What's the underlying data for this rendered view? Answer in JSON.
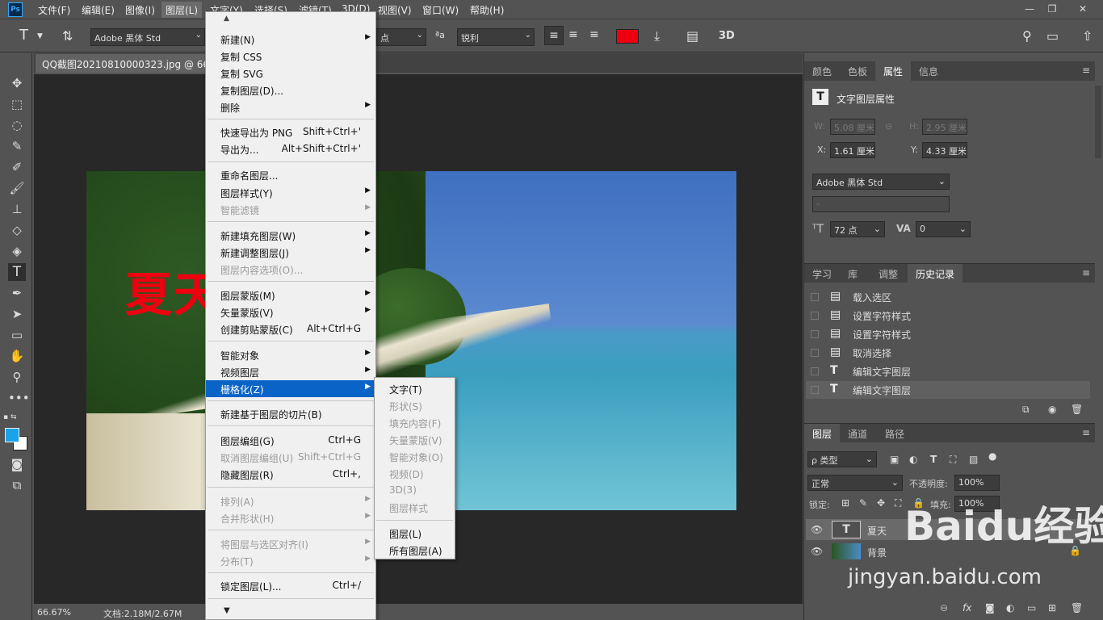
{
  "menubar": {
    "logo": "Ps",
    "items": [
      "文件(F)",
      "编辑(E)",
      "图像(I)",
      "图层(L)",
      "文字(Y)",
      "选择(S)",
      "滤镜(T)",
      "3D(D)",
      "视图(V)",
      "窗口(W)",
      "帮助(H)"
    ]
  },
  "options": {
    "font_family": "Adobe 黑体 Std",
    "size_unit": "点",
    "aa_label": "ªa",
    "aa_mode": "锐利",
    "color": "#ee0010",
    "threed": "3D"
  },
  "document": {
    "tab_title": "QQ截图20210810000323.jpg @ 66.7%",
    "canvas_text": "夏天"
  },
  "status": {
    "zoom": "66.67%",
    "doc_size": "文档:2.18M/2.67M"
  },
  "properties": {
    "tabs": [
      "颜色",
      "色板",
      "属性",
      "信息"
    ],
    "header": "文字图层属性",
    "w_label": "W:",
    "w_value": "5.08 厘米",
    "h_label": "H:",
    "h_value": "2.95 厘米",
    "x_label": "X:",
    "x_value": "1.61 厘米",
    "y_label": "Y:",
    "y_value": "4.33 厘米",
    "font": "Adobe 黑体 Std",
    "style": "-",
    "size": "72 点",
    "tracking": "0"
  },
  "history": {
    "tabs": [
      "学习",
      "库",
      "调整",
      "历史记录"
    ],
    "items": [
      {
        "icon": "doc",
        "label": "载入选区"
      },
      {
        "icon": "doc",
        "label": "设置字符样式"
      },
      {
        "icon": "doc",
        "label": "设置字符样式"
      },
      {
        "icon": "doc",
        "label": "取消选择"
      },
      {
        "icon": "T",
        "label": "编辑文字图层"
      },
      {
        "icon": "T",
        "label": "编辑文字图层"
      }
    ]
  },
  "layers": {
    "tabs": [
      "图层",
      "通道",
      "路径"
    ],
    "filter": "ρ 类型",
    "blend": "正常",
    "opacity_label": "不透明度:",
    "opacity": "100%",
    "lock_label": "锁定:",
    "fill_label": "填充:",
    "fill": "100%",
    "rows": [
      {
        "name": "夏天",
        "type": "T"
      },
      {
        "name": "背景",
        "type": "image"
      }
    ]
  },
  "layer_menu": {
    "items": [
      {
        "label": "新建(N)",
        "arrow": true
      },
      {
        "label": "复制 CSS"
      },
      {
        "label": "复制 SVG"
      },
      {
        "label": "复制图层(D)..."
      },
      {
        "label": "删除",
        "arrow": true
      },
      {
        "label": "快速导出为 PNG",
        "shortcut": "Shift+Ctrl+'"
      },
      {
        "label": "导出为...",
        "shortcut": "Alt+Shift+Ctrl+'"
      },
      {
        "label": "重命名图层..."
      },
      {
        "label": "图层样式(Y)",
        "arrow": true
      },
      {
        "label": "智能滤镜",
        "arrow": true,
        "disabled": true
      },
      {
        "label": "新建填充图层(W)",
        "arrow": true
      },
      {
        "label": "新建调整图层(J)",
        "arrow": true
      },
      {
        "label": "图层内容选项(O)...",
        "disabled": true
      },
      {
        "label": "图层蒙版(M)",
        "arrow": true
      },
      {
        "label": "矢量蒙版(V)",
        "arrow": true
      },
      {
        "label": "创建剪贴蒙版(C)",
        "shortcut": "Alt+Ctrl+G"
      },
      {
        "label": "智能对象",
        "arrow": true
      },
      {
        "label": "视频图层",
        "arrow": true
      },
      {
        "label": "栅格化(Z)",
        "arrow": true,
        "highlight": true
      },
      {
        "label": "新建基于图层的切片(B)"
      },
      {
        "label": "图层编组(G)",
        "shortcut": "Ctrl+G"
      },
      {
        "label": "取消图层编组(U)",
        "shortcut": "Shift+Ctrl+G",
        "disabled": true
      },
      {
        "label": "隐藏图层(R)",
        "shortcut": "Ctrl+,"
      },
      {
        "label": "排列(A)",
        "arrow": true,
        "disabled": true
      },
      {
        "label": "合并形状(H)",
        "arrow": true,
        "disabled": true
      },
      {
        "label": "将图层与选区对齐(I)",
        "arrow": true,
        "disabled": true
      },
      {
        "label": "分布(T)",
        "arrow": true,
        "disabled": true
      },
      {
        "label": "锁定图层(L)...",
        "shortcut": "Ctrl+/"
      }
    ]
  },
  "raster_menu": {
    "items": [
      {
        "label": "文字(T)"
      },
      {
        "label": "形状(S)",
        "disabled": true
      },
      {
        "label": "填充内容(F)",
        "disabled": true
      },
      {
        "label": "矢量蒙版(V)",
        "disabled": true
      },
      {
        "label": "智能对象(O)",
        "disabled": true
      },
      {
        "label": "视频(D)",
        "disabled": true
      },
      {
        "label": "3D(3)",
        "disabled": true
      },
      {
        "label": "图层样式",
        "disabled": true
      },
      {
        "label": "图层(L)"
      },
      {
        "label": "所有图层(A)"
      }
    ]
  },
  "watermark": {
    "brand": "Baidu经验",
    "url": "jingyan.baidu.com"
  }
}
